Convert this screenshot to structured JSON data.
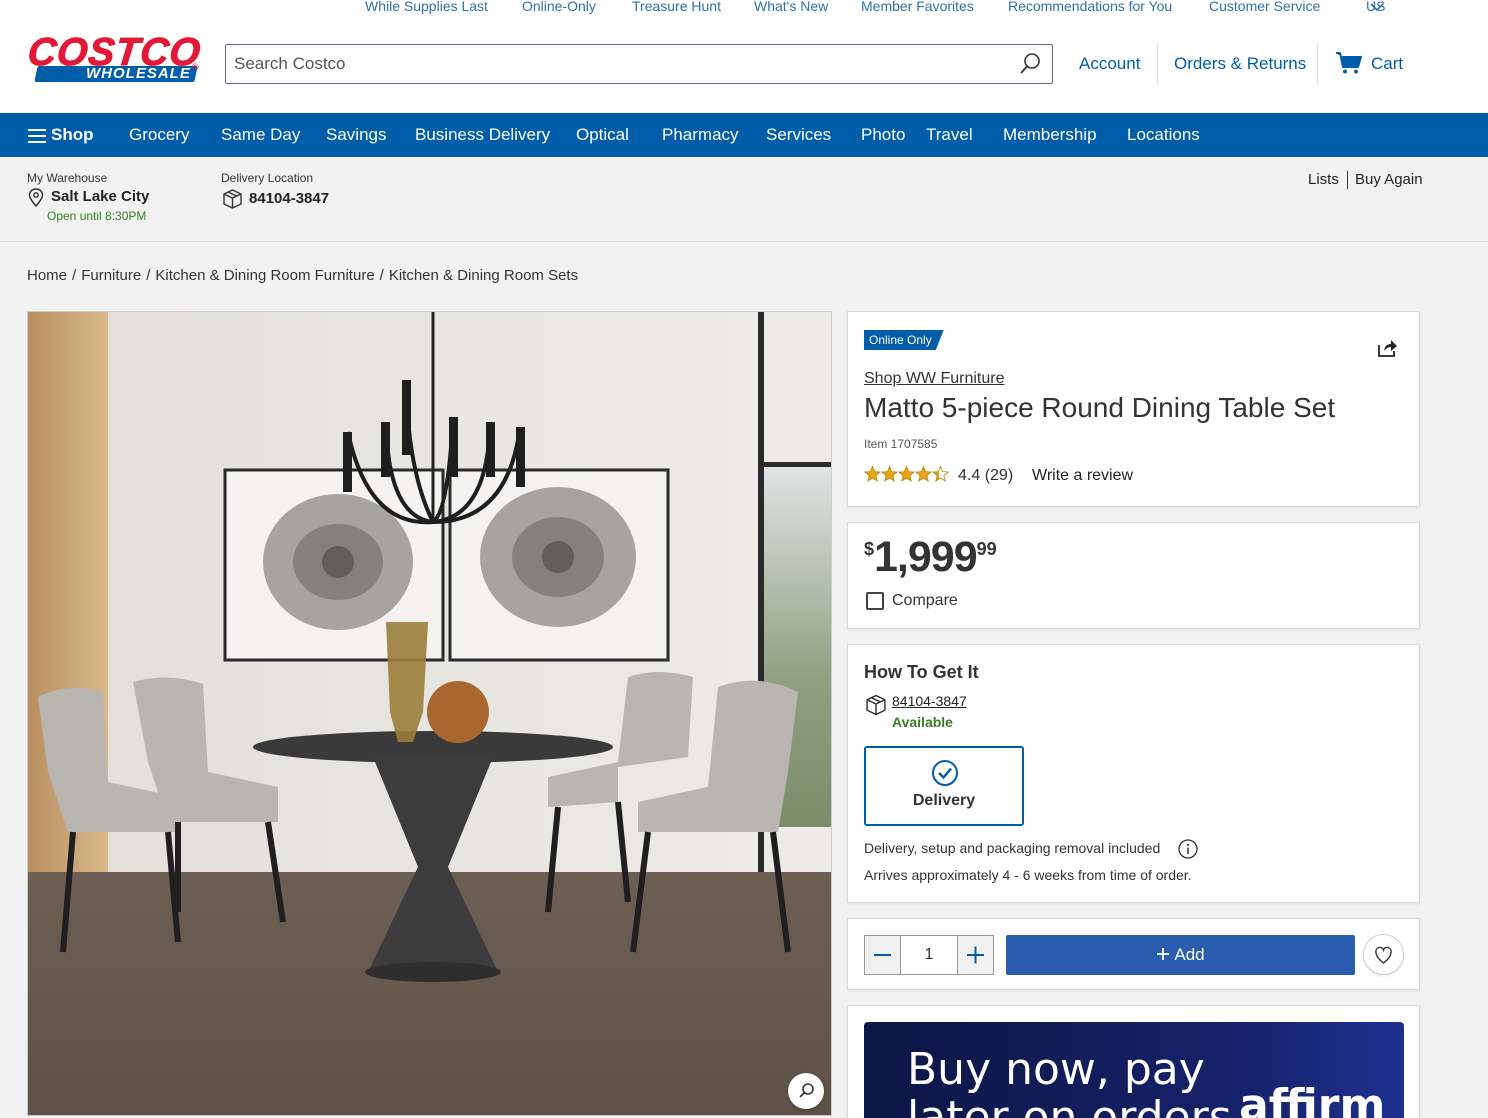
{
  "util_links": [
    "While Supplies Last",
    "Online-Only",
    "Treasure Hunt",
    "What's New",
    "Member Favorites",
    "Recommendations for You",
    "Customer Service",
    "US"
  ],
  "logo": {
    "top": "COSTCO",
    "bottom": "WHOLESALE",
    "reg": "®"
  },
  "search": {
    "placeholder": "Search Costco"
  },
  "header": {
    "account": "Account",
    "orders": "Orders & Returns",
    "cart": "Cart"
  },
  "nav": {
    "shop": "Shop",
    "items": [
      "Grocery",
      "Same Day",
      "Savings",
      "Business Delivery",
      "Optical",
      "Pharmacy",
      "Services",
      "Photo",
      "Travel",
      "Membership",
      "Locations"
    ]
  },
  "location": {
    "warehouse_label": "My Warehouse",
    "warehouse": "Salt Lake City",
    "hours": "Open until 8:30PM",
    "delivery_label": "Delivery Location",
    "zip": "84104-3847",
    "lists": "Lists",
    "buy_again": "Buy Again"
  },
  "breadcrumb": [
    "Home",
    "Furniture",
    "Kitchen & Dining Room Furniture",
    "Kitchen & Dining Room Sets"
  ],
  "product": {
    "badge": "Online Only",
    "brand": "Shop WW Furniture",
    "title": "Matto 5-piece Round Dining Table Set",
    "item": "Item 1707585",
    "rating_value": 4.4,
    "rating": "4.4 (29)",
    "write_review": "Write a review",
    "price_dollar": "$",
    "price_main": "1,999",
    "price_cents": "99",
    "compare": "Compare"
  },
  "fulfillment": {
    "heading": "How To Get It",
    "zip": "84104-3847",
    "status": "Available",
    "option": "Delivery",
    "note1": "Delivery, setup and packaging removal included",
    "note2": "Arrives approximately 4 - 6 weeks from time of order."
  },
  "cart_controls": {
    "qty": "1",
    "add": "Add"
  },
  "affirm": {
    "line1": "Buy now, pay",
    "line2": "later on orders",
    "logo": "affirm"
  },
  "colors": {
    "brand_blue": "#005daa",
    "brand_red": "#e31837",
    "available_green": "#3a7d22",
    "link_blue": "#3071a9"
  }
}
